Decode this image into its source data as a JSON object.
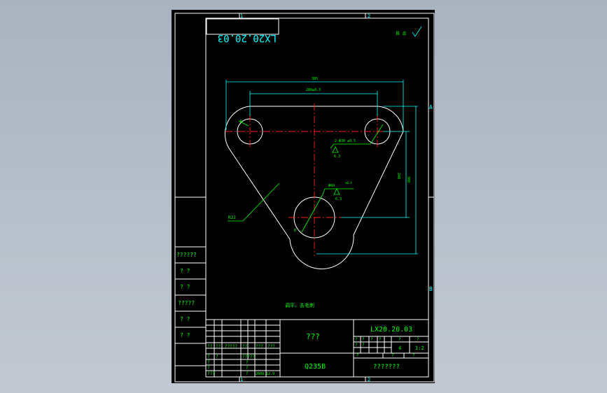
{
  "drawing": {
    "code_mirrored": "LX20.20.03",
    "roughness_note": "其 余",
    "zone_top_1": "1",
    "zone_top_2": "2",
    "zone_bottom_1": "1",
    "zone_bottom_2": "2",
    "zone_right_a": "A",
    "zone_right_b": "B",
    "dim_overall_width": "385",
    "dim_hole_spacing": "280±0.3",
    "dim_small_holes": "2-Φ30 ±0.5",
    "dim_small_roughness": "6.3",
    "dim_big_hole": "Φ60",
    "dim_big_hole_tol": "±0.4",
    "dim_big_roughness": "6.3",
    "dim_small_radius": "R",
    "dim_big_radius": "R",
    "dim_height_inner": "240",
    "dim_height_outer": "300",
    "dim_side_radius": "R22",
    "tech_note": "调平、去毛刺"
  },
  "side_table": {
    "rows": [
      "??????",
      "?  ?",
      "?  ?",
      "?????",
      "?  ?",
      "?  ?"
    ]
  },
  "title_block": {
    "part_name": "???",
    "material": "Q235B",
    "code": "LX20.20.03",
    "stage_headers": [
      "?",
      "?",
      "?",
      "?",
      "?",
      "?",
      "?",
      "?"
    ],
    "count": "4",
    "scale": "1:2",
    "sheet_labels": [
      "?",
      "?",
      "?"
    ],
    "company": "???????",
    "sign_row_labels": [
      "??",
      "??",
      "?????",
      "??",
      "???",
      "???"
    ],
    "design_rows": [
      "?",
      "?",
      "?",
      "?",
      "???"
    ],
    "design_mid": [
      "?????",
      "?",
      "?",
      "?"
    ],
    "date": "2009.12.9"
  }
}
